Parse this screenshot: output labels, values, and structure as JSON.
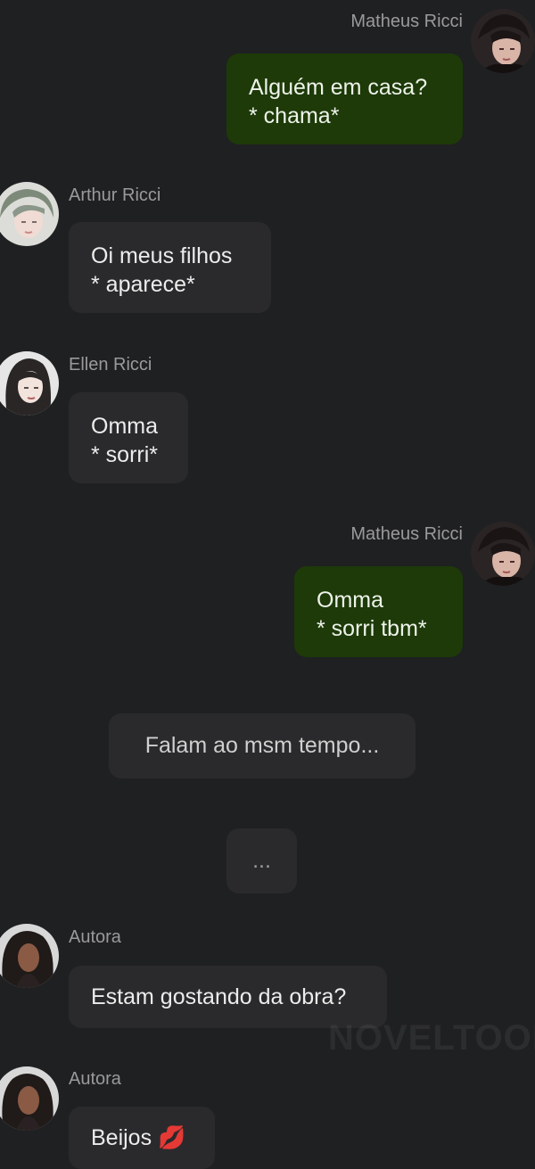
{
  "messages": [
    {
      "sender": "Matheus Ricci",
      "side": "right",
      "text": "Alguém em casa?\n* chama*"
    },
    {
      "sender": "Arthur Ricci",
      "side": "left",
      "text": "Oi meus filhos\n* aparece*"
    },
    {
      "sender": "Ellen Ricci",
      "side": "left",
      "text": "Omma\n* sorri*"
    },
    {
      "sender": "Matheus Ricci",
      "side": "right",
      "text": "Omma\n* sorri tbm*"
    },
    {
      "sender": "Autora",
      "side": "left",
      "text": "Estam gostando da obra?"
    },
    {
      "sender": "Autora",
      "side": "left",
      "text": "Beijos 💋"
    }
  ],
  "narration": {
    "line1": "Falam ao msm tempo...",
    "line2": "..."
  },
  "watermark": "NOVELTOON",
  "colors": {
    "background": "#1f2022",
    "own_bubble": "#1d3a08",
    "other_bubble": "#2a2a2c",
    "name_text": "#9a9a9a"
  }
}
